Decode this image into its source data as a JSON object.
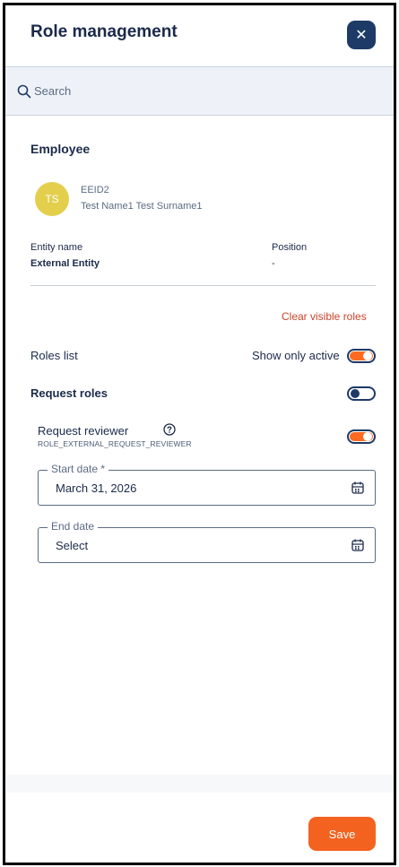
{
  "header": {
    "title": "Role management",
    "close_symbol": "✕"
  },
  "search": {
    "placeholder": "Search"
  },
  "employee": {
    "section_title": "Employee",
    "initials": "TS",
    "avatar_color": "#e3cf4c",
    "id": "EEID2",
    "full_name": "Test Name1 Test Surname1",
    "entity_label": "Entity name",
    "entity_value": "External Entity",
    "position_label": "Position",
    "position_value": "-"
  },
  "roles": {
    "clear_visible": "Clear visible roles",
    "list_label": "Roles list",
    "show_only_active_label": "Show only active",
    "show_only_active": true,
    "request_roles_label": "Request roles",
    "request_roles_enabled": false,
    "items": [
      {
        "label": "Request reviewer",
        "code": "ROLE_EXTERNAL_REQUEST_REVIEWER",
        "enabled": true,
        "start_date_label": "Start date *",
        "start_date_value": "March 31, 2026",
        "end_date_label": "End date",
        "end_date_value": "Select"
      }
    ]
  },
  "footer": {
    "save_label": "Save"
  },
  "colors": {
    "accent": "#f4621f",
    "primary_dark": "#1e3a67",
    "link_red": "#c9442b",
    "search_bg": "#eef2f8"
  },
  "icons": [
    "close-icon",
    "search-icon",
    "help-icon",
    "calendar-icon"
  ]
}
